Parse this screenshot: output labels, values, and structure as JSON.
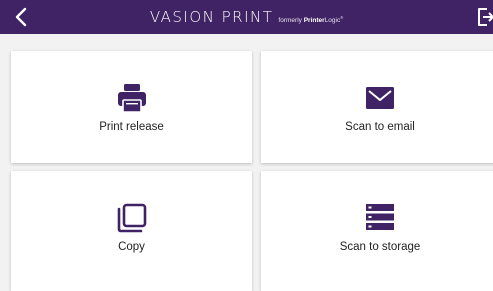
{
  "header": {
    "brand_name": "VASION PRINT",
    "brand_tagline_prefix": "formerly",
    "brand_tagline_bold": "Printer",
    "brand_tagline_light": "Logic",
    "brand_tagline_mark": "®",
    "background_color": "#3f2364",
    "back_icon": "chevron-left-icon",
    "exit_icon": "logout-icon"
  },
  "tiles": [
    {
      "label": "Print release",
      "icon": "printer-icon"
    },
    {
      "label": "Scan to email",
      "icon": "envelope-icon"
    },
    {
      "label": "Copy",
      "icon": "copy-icon"
    },
    {
      "label": "Scan to storage",
      "icon": "storage-icon"
    }
  ],
  "colors": {
    "accent": "#3f2364",
    "tile_bg": "#ffffff",
    "page_bg": "#f2f2f2"
  }
}
